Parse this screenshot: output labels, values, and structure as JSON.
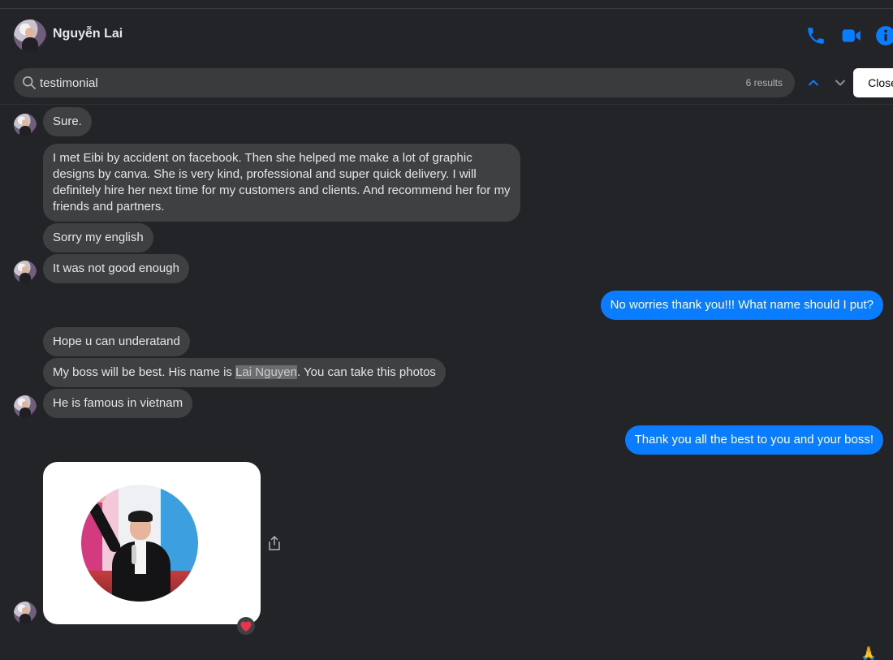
{
  "header": {
    "contact_name": "Nguyễn Lai"
  },
  "search": {
    "value": "testimonial",
    "results": "6 results",
    "close_label": "Close"
  },
  "messages": {
    "m1": "Sure.",
    "m2": "I met Eibi by accident on facebook. Then she helped me make a lot of graphic designs by canva. She is very kind, professional and super quick delivery. I will definitely hire her next time for my customers and clients. And recommend her for my friends and partners.",
    "m3": "Sorry my english",
    "m4": "It was not good enough",
    "m5": "No worries thank you!!! What name should I put?",
    "m6": "Hope u can underatand",
    "m7_pre": "My boss will be best. His name is ",
    "m7_hl": "Lai Nguyen",
    "m7_post": ". You can take this photos",
    "m8": "He is famous in vietnam",
    "m9": "Thank you all the best to you and your boss!"
  },
  "icons": {
    "phone": "phone-icon",
    "video": "video-camera-icon",
    "info": "info-icon",
    "search": "search-icon",
    "up": "chevron-up-icon",
    "down": "chevron-down-icon",
    "share": "share-icon",
    "reaction": "heart-reaction-icon",
    "pray": "folded-hands-emoji-icon"
  },
  "colors": {
    "background": "#232427",
    "incoming_bubble": "#3e4042",
    "outgoing_bubble": "#0a7cff",
    "accent": "#0a7cff"
  }
}
